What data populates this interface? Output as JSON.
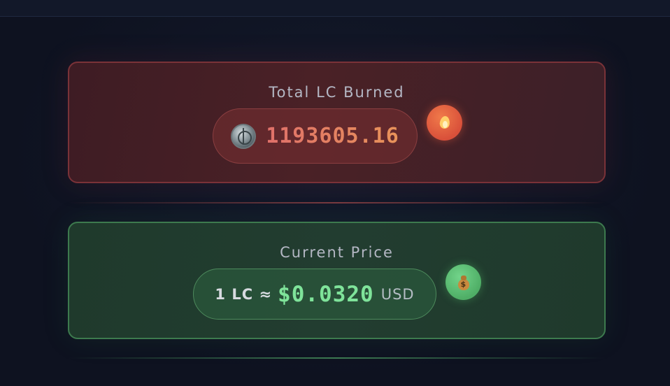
{
  "burn_card": {
    "title": "Total LC Burned",
    "value": "1193605.16",
    "coin_icon": "lc-coin-icon",
    "badge_icon": "fire-icon"
  },
  "price_card": {
    "title": "Current Price",
    "prefix": "1 LC ≈",
    "value": "$0.0320",
    "unit": "USD",
    "badge_icon": "money-bag-icon"
  },
  "colors": {
    "background": "#0f1322",
    "burn_accent": "#e0706a",
    "burn_border": "#7a3238",
    "price_accent": "#7fe39a",
    "price_border": "#3d7a4e"
  }
}
